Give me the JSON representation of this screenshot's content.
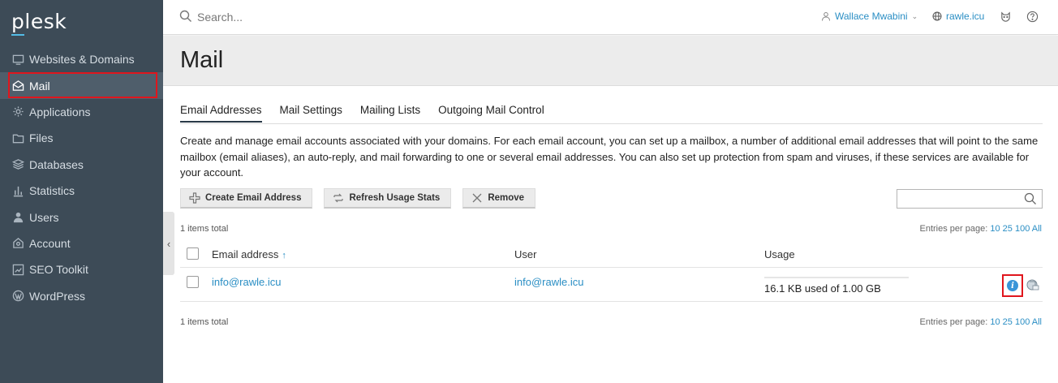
{
  "brand": {
    "logo": "plesk"
  },
  "sidebar": {
    "items": [
      {
        "label": "Websites & Domains",
        "icon": "monitor-icon"
      },
      {
        "label": "Mail",
        "icon": "envelope-icon",
        "active": true
      },
      {
        "label": "Applications",
        "icon": "gear-icon"
      },
      {
        "label": "Files",
        "icon": "folder-icon"
      },
      {
        "label": "Databases",
        "icon": "layers-icon"
      },
      {
        "label": "Statistics",
        "icon": "bar-chart-icon"
      },
      {
        "label": "Users",
        "icon": "user-icon"
      },
      {
        "label": "Account",
        "icon": "account-icon"
      },
      {
        "label": "SEO Toolkit",
        "icon": "seo-chart-icon"
      },
      {
        "label": "WordPress",
        "icon": "wordpress-icon"
      }
    ]
  },
  "topbar": {
    "search_placeholder": "Search...",
    "user_name": "Wallace Mwabini",
    "domain": "rawle.icu"
  },
  "page": {
    "title": "Mail"
  },
  "tabs": [
    {
      "label": "Email Addresses",
      "active": true
    },
    {
      "label": "Mail Settings"
    },
    {
      "label": "Mailing Lists"
    },
    {
      "label": "Outgoing Mail Control"
    }
  ],
  "description": "Create and manage email accounts associated with your domains. For each email account, you can set up a mailbox, a number of additional email addresses that will point to the same mailbox (email aliases), an auto-reply, and mail forwarding to one or several email addresses. You can also set up protection from spam and viruses, if these services are available for your account.",
  "toolbar": {
    "create_label": "Create Email Address",
    "refresh_label": "Refresh Usage Stats",
    "remove_label": "Remove"
  },
  "list": {
    "items_total": "1 items total",
    "entries_per_page_label": "Entries per page:",
    "page_sizes": [
      "10",
      "25",
      "100",
      "All"
    ],
    "columns": {
      "email": "Email address",
      "sort_indicator": "↑",
      "user": "User",
      "usage": "Usage"
    },
    "rows": [
      {
        "email": "info@rawle.icu",
        "user": "info@rawle.icu",
        "usage": "16.1 KB used of 1.00 GB",
        "usage_fraction": 0.0
      }
    ]
  },
  "colors": {
    "sidebar_bg": "#3d4b57",
    "link": "#2a8ec4",
    "highlight": "#e0161d"
  }
}
